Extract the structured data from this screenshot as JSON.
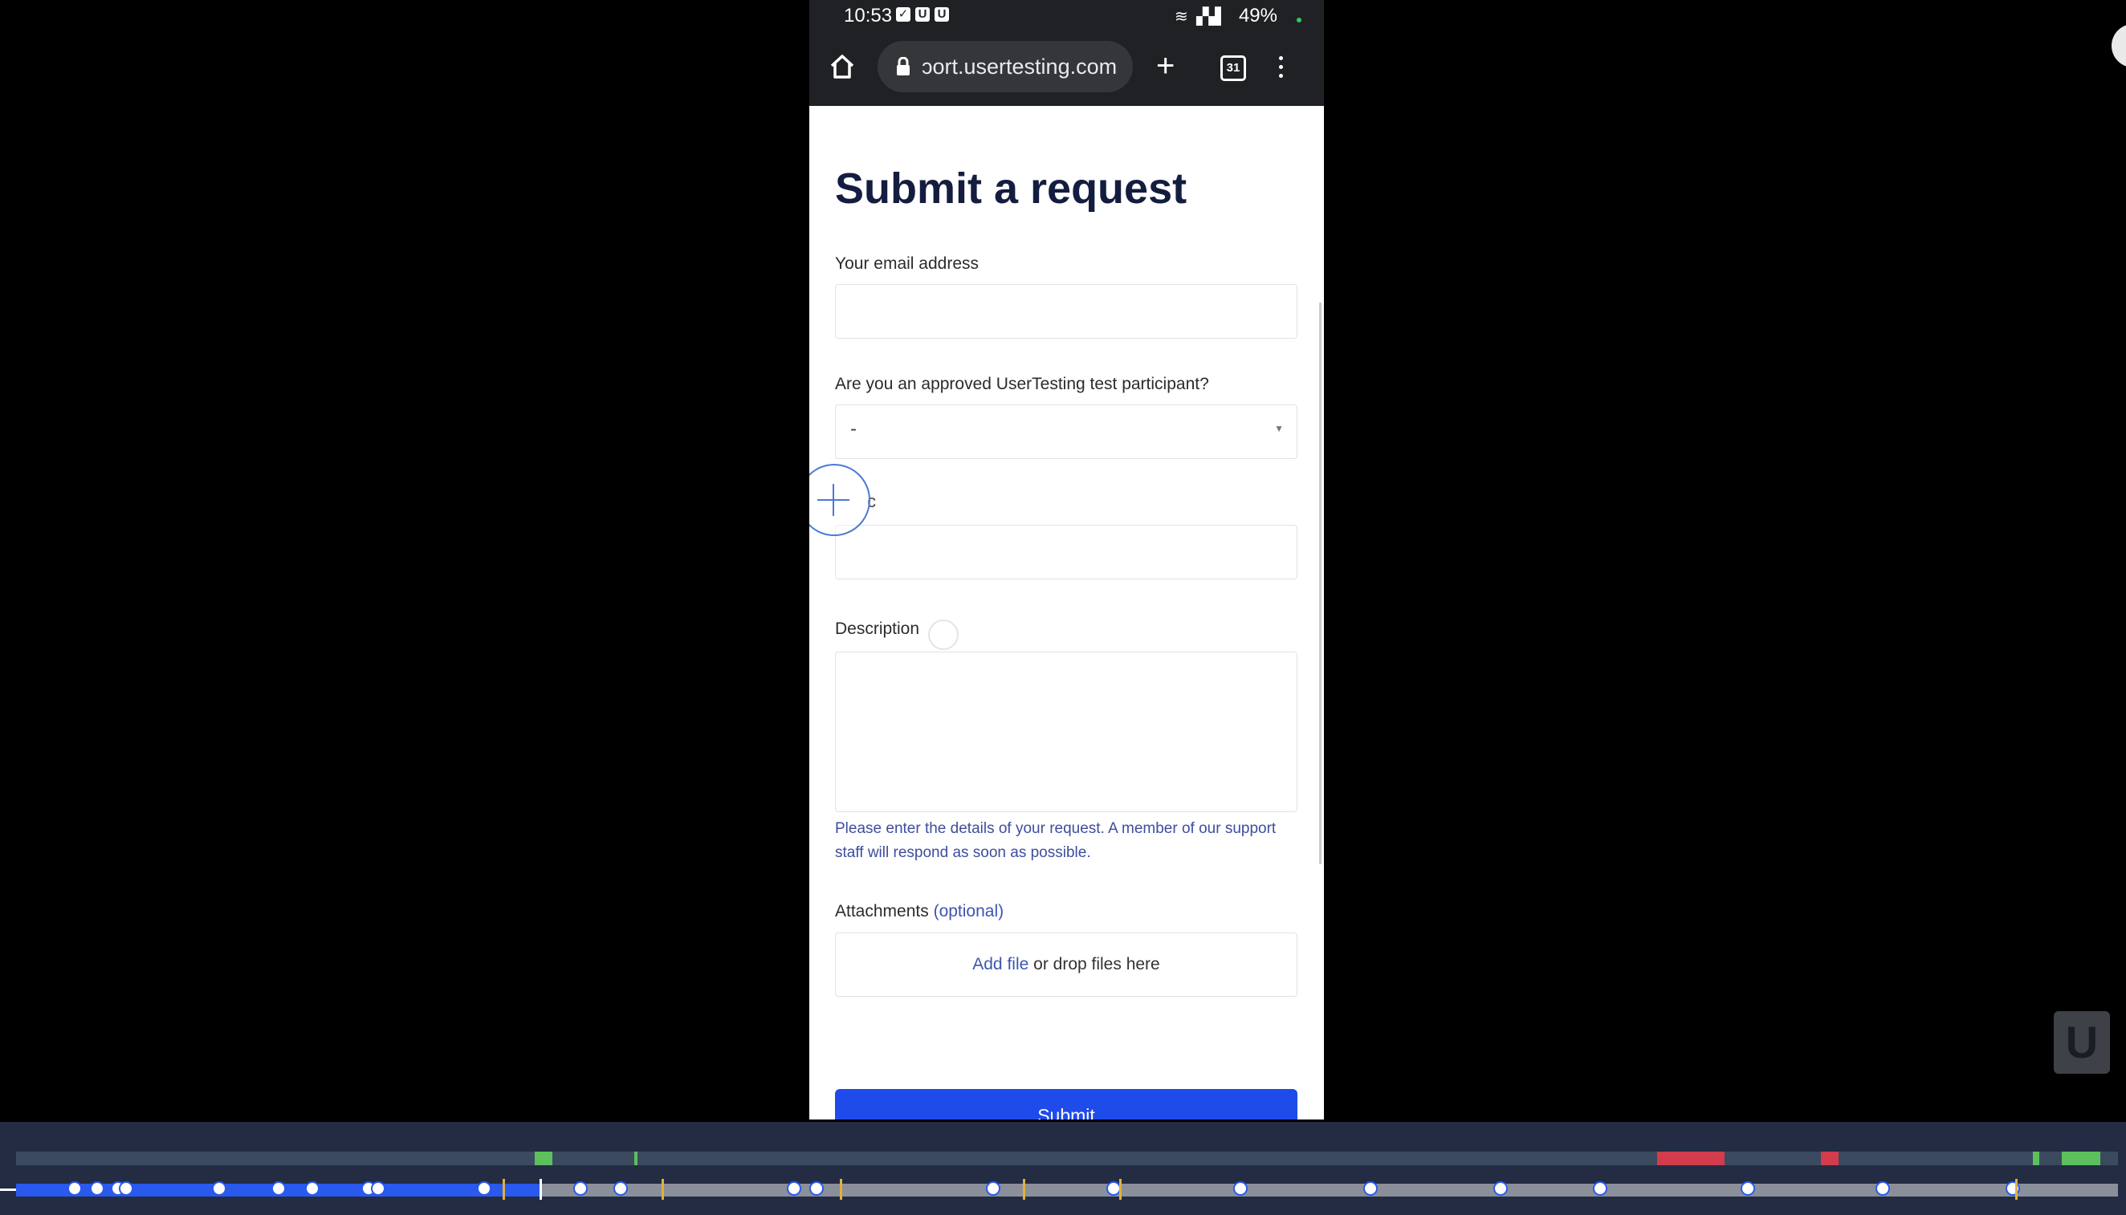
{
  "status_bar": {
    "time": "10:53",
    "battery": "49%"
  },
  "browser": {
    "url": "ɔort.usertesting.com",
    "tabs_count": "31"
  },
  "form": {
    "title": "Submit a request",
    "email_label": "Your email address",
    "participant_label": "Are you an approved UserTesting test participant?",
    "participant_value": "-",
    "subject_label_fragment": "c",
    "description_label": "Description",
    "description_hint": "Please enter the details of your request. A member of our support staff will respond as soon as possible.",
    "attachments_label": "Attachments",
    "attachments_optional": "(optional)",
    "add_file_link": "Add file",
    "drop_text": "or drop files here",
    "submit_label": "Submit"
  },
  "overlay": {
    "logo_letter": "U"
  },
  "colors": {
    "brand_blue": "#1f4bea",
    "timeline_bg": "#232c42",
    "segment_green": "#5cc05c",
    "segment_red": "#d23c4c"
  },
  "icons": [
    "home-icon",
    "lock-icon",
    "new-tab-icon",
    "tabs-icon",
    "more-menu-icon",
    "touch-indicator-icon"
  ]
}
